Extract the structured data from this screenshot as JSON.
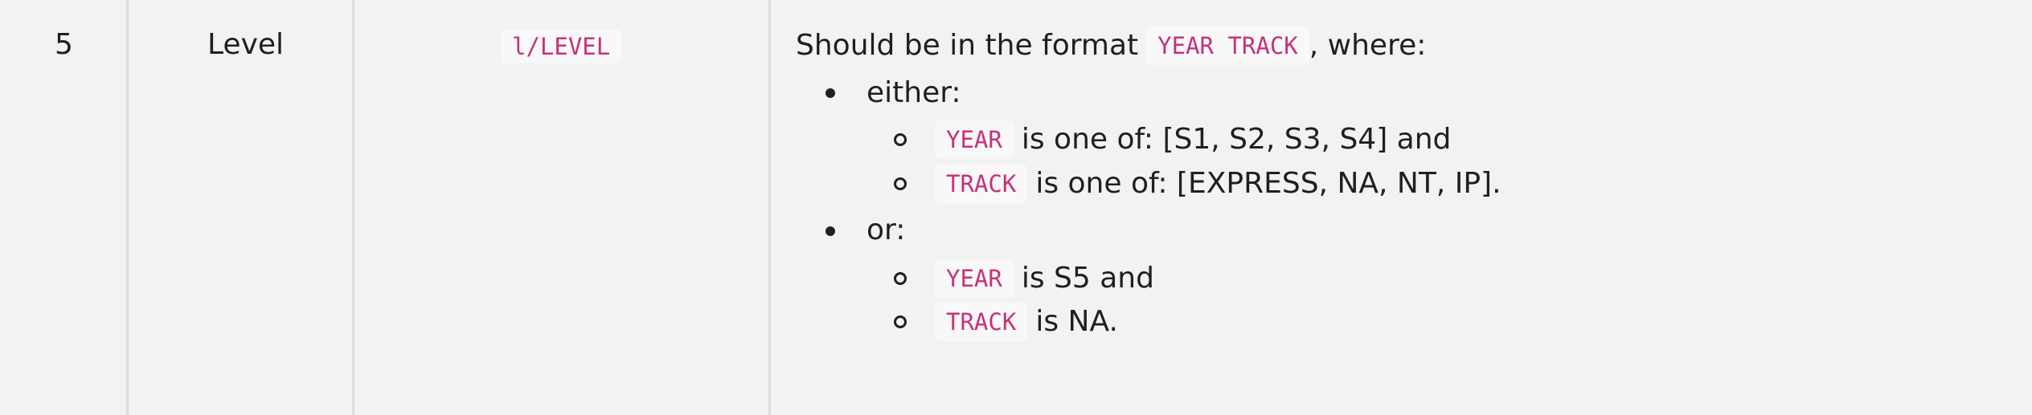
{
  "row": {
    "index": "5",
    "field": "Level",
    "prefix": "l/LEVEL",
    "description": {
      "intro_before": "Should be in the format",
      "intro_code": "YEAR TRACK",
      "intro_after": ", where:",
      "groups": [
        {
          "label": "either:",
          "items": [
            {
              "code": "YEAR",
              "text": "is one of: [S1, S2, S3, S4] and"
            },
            {
              "code": "TRACK",
              "text": "is one of: [EXPRESS, NA, NT, IP]."
            }
          ]
        },
        {
          "label": "or:",
          "items": [
            {
              "code": "YEAR",
              "text": "is S5 and"
            },
            {
              "code": "TRACK",
              "text": "is NA."
            }
          ]
        }
      ]
    }
  },
  "colors": {
    "background": "#f2f2f2",
    "divider": "#dcdcdc",
    "code_text": "#c7327a",
    "code_background": "#f8f8f8",
    "text": "#1f1f1f"
  }
}
